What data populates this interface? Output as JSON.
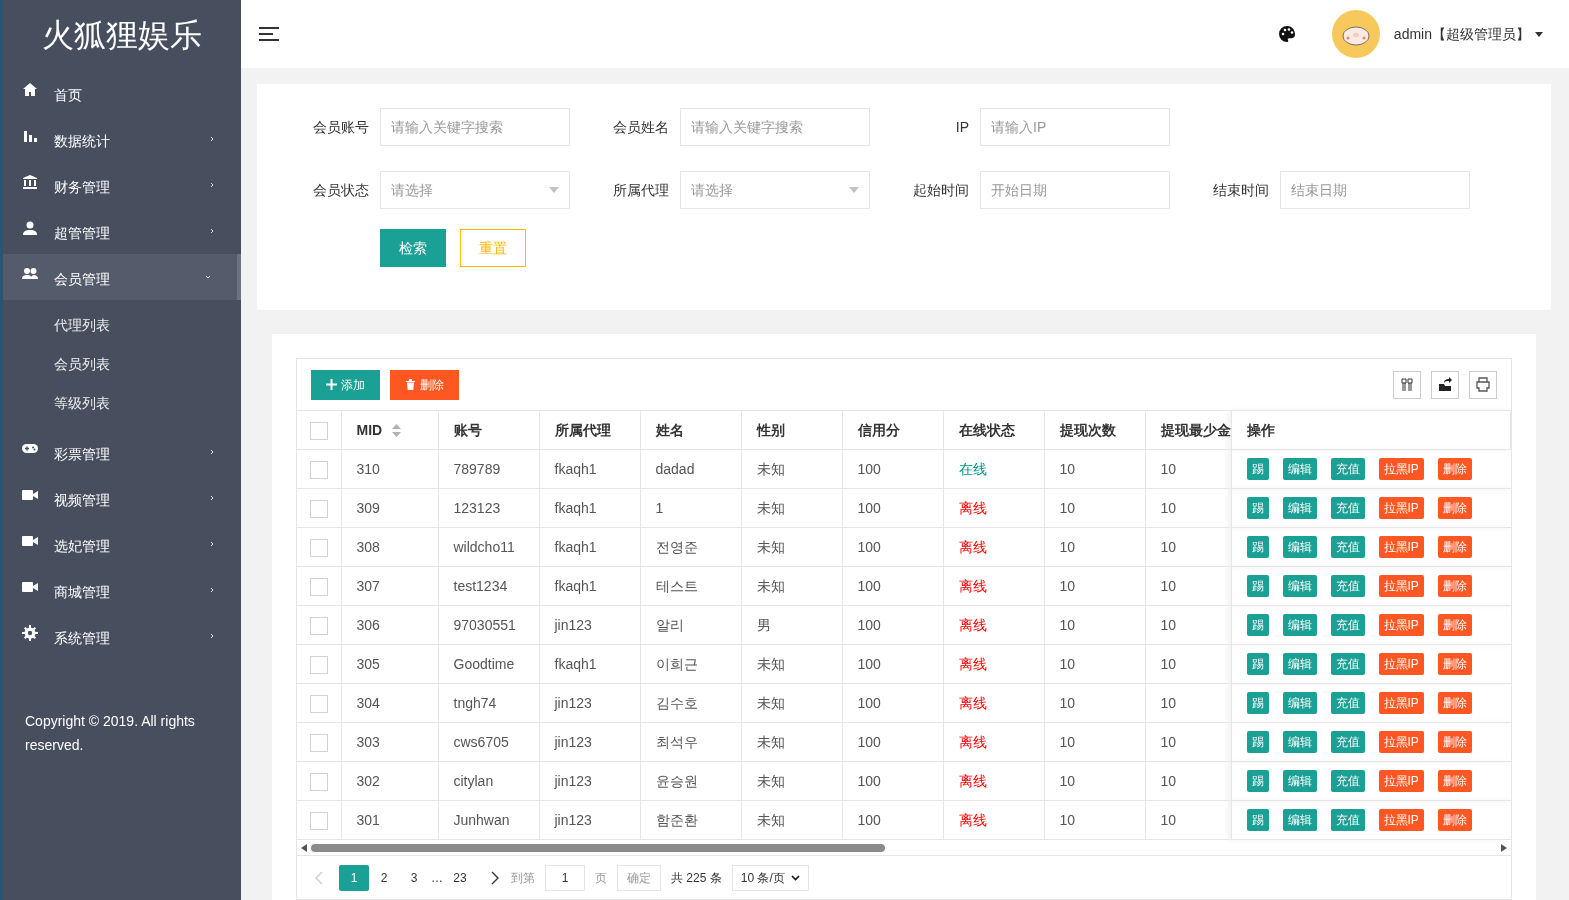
{
  "sidebar": {
    "logo": "火狐狸娱乐",
    "items": [
      {
        "kind": "home",
        "label": "首页",
        "has_children": false,
        "selected": false
      },
      {
        "kind": "chart",
        "label": "数据统计",
        "has_children": true,
        "expanded": false,
        "selected": false
      },
      {
        "kind": "bank",
        "label": "财务管理",
        "has_children": true,
        "expanded": false,
        "selected": false
      },
      {
        "kind": "user",
        "label": "超管管理",
        "has_children": true,
        "expanded": false,
        "selected": false
      },
      {
        "kind": "users",
        "label": "会员管理",
        "has_children": true,
        "expanded": true,
        "selected": true,
        "children": [
          {
            "label": "代理列表"
          },
          {
            "label": "会员列表"
          },
          {
            "label": "等级列表"
          }
        ]
      },
      {
        "kind": "gamepad",
        "label": "彩票管理",
        "has_children": true,
        "expanded": false,
        "selected": false
      },
      {
        "kind": "video",
        "label": "视频管理",
        "has_children": true,
        "expanded": false,
        "selected": false
      },
      {
        "kind": "video",
        "label": "选妃管理",
        "has_children": true,
        "expanded": false,
        "selected": false
      },
      {
        "kind": "video",
        "label": "商城管理",
        "has_children": true,
        "expanded": false,
        "selected": false
      },
      {
        "kind": "gear",
        "label": "系统管理",
        "has_children": true,
        "expanded": false,
        "selected": false
      }
    ],
    "copyright": "Copyright © 2019. All rights reserved."
  },
  "header": {
    "user": "admin【超级管理员】"
  },
  "filter_rows": [
    [
      {
        "label": "会员账号",
        "kind": "text",
        "placeholder": "请输入关键字搜索"
      },
      {
        "label": "会员姓名",
        "kind": "text",
        "placeholder": "请输入关键字搜索"
      },
      {
        "label": "IP",
        "kind": "text",
        "placeholder": "请输入IP"
      }
    ],
    [
      {
        "label": "会员状态",
        "kind": "select",
        "placeholder": "请选择"
      },
      {
        "label": "所属代理",
        "kind": "select",
        "placeholder": "请选择"
      },
      {
        "label": "起始时间",
        "kind": "text",
        "placeholder": "开始日期"
      },
      {
        "label": "结束时间",
        "kind": "text",
        "placeholder": "结束日期"
      }
    ]
  ],
  "filter_buttons": [
    {
      "label": "检索",
      "kind": "primary"
    },
    {
      "label": "重置",
      "kind": "outline"
    }
  ],
  "toolbar": [
    {
      "label": "添加",
      "kind": "add"
    },
    {
      "label": "删除",
      "kind": "delete"
    }
  ],
  "table": {
    "all_checked": false,
    "columns": [
      "MID",
      "账号",
      "所属代理",
      "姓名",
      "性别",
      "信用分",
      "在线状态",
      "提现次数",
      "提现最少金",
      "操作"
    ],
    "rows": [
      {
        "checked": false,
        "cells": [
          "310",
          "789789",
          "fkaqh1",
          "dadad",
          "未知",
          "100",
          "在线",
          "10",
          "10"
        ],
        "online": true,
        "actions": [
          {
            "label": "踢",
            "kind": "normal"
          },
          {
            "label": "编辑",
            "kind": "normal"
          },
          {
            "label": "充值",
            "kind": "normal"
          },
          {
            "label": "拉黑IP",
            "kind": "danger"
          },
          {
            "label": "删除",
            "kind": "danger"
          }
        ]
      },
      {
        "checked": false,
        "cells": [
          "309",
          "123123",
          "fkaqh1",
          "1",
          "未知",
          "100",
          "离线",
          "10",
          "10"
        ],
        "online": false,
        "actions": [
          {
            "label": "踢",
            "kind": "normal"
          },
          {
            "label": "编辑",
            "kind": "normal"
          },
          {
            "label": "充值",
            "kind": "normal"
          },
          {
            "label": "拉黑IP",
            "kind": "danger"
          },
          {
            "label": "删除",
            "kind": "danger"
          }
        ]
      },
      {
        "checked": false,
        "cells": [
          "308",
          "wildcho11",
          "fkaqh1",
          "전영준",
          "未知",
          "100",
          "离线",
          "10",
          "10"
        ],
        "online": false,
        "actions": [
          {
            "label": "踢",
            "kind": "normal"
          },
          {
            "label": "编辑",
            "kind": "normal"
          },
          {
            "label": "充值",
            "kind": "normal"
          },
          {
            "label": "拉黑IP",
            "kind": "danger"
          },
          {
            "label": "删除",
            "kind": "danger"
          }
        ]
      },
      {
        "checked": false,
        "cells": [
          "307",
          "test1234",
          "fkaqh1",
          "테스트",
          "未知",
          "100",
          "离线",
          "10",
          "10"
        ],
        "online": false,
        "actions": [
          {
            "label": "踢",
            "kind": "normal"
          },
          {
            "label": "编辑",
            "kind": "normal"
          },
          {
            "label": "充值",
            "kind": "normal"
          },
          {
            "label": "拉黑IP",
            "kind": "danger"
          },
          {
            "label": "删除",
            "kind": "danger"
          }
        ]
      },
      {
        "checked": false,
        "cells": [
          "306",
          "97030551",
          "jin123",
          "알리",
          "男",
          "100",
          "离线",
          "10",
          "10"
        ],
        "online": false,
        "actions": [
          {
            "label": "踢",
            "kind": "normal"
          },
          {
            "label": "编辑",
            "kind": "normal"
          },
          {
            "label": "充值",
            "kind": "normal"
          },
          {
            "label": "拉黑IP",
            "kind": "danger"
          },
          {
            "label": "删除",
            "kind": "danger"
          }
        ]
      },
      {
        "checked": false,
        "cells": [
          "305",
          "Goodtime",
          "fkaqh1",
          "이희근",
          "未知",
          "100",
          "离线",
          "10",
          "10"
        ],
        "online": false,
        "actions": [
          {
            "label": "踢",
            "kind": "normal"
          },
          {
            "label": "编辑",
            "kind": "normal"
          },
          {
            "label": "充值",
            "kind": "normal"
          },
          {
            "label": "拉黑IP",
            "kind": "danger"
          },
          {
            "label": "删除",
            "kind": "danger"
          }
        ]
      },
      {
        "checked": false,
        "cells": [
          "304",
          "tngh74",
          "jin123",
          "김수호",
          "未知",
          "100",
          "离线",
          "10",
          "10"
        ],
        "online": false,
        "actions": [
          {
            "label": "踢",
            "kind": "normal"
          },
          {
            "label": "编辑",
            "kind": "normal"
          },
          {
            "label": "充值",
            "kind": "normal"
          },
          {
            "label": "拉黑IP",
            "kind": "danger"
          },
          {
            "label": "删除",
            "kind": "danger"
          }
        ]
      },
      {
        "checked": false,
        "cells": [
          "303",
          "cws6705",
          "jin123",
          "최석우",
          "未知",
          "100",
          "离线",
          "10",
          "10"
        ],
        "online": false,
        "actions": [
          {
            "label": "踢",
            "kind": "normal"
          },
          {
            "label": "编辑",
            "kind": "normal"
          },
          {
            "label": "充值",
            "kind": "normal"
          },
          {
            "label": "拉黑IP",
            "kind": "danger"
          },
          {
            "label": "删除",
            "kind": "danger"
          }
        ]
      },
      {
        "checked": false,
        "cells": [
          "302",
          "citylan",
          "jin123",
          "윤승원",
          "未知",
          "100",
          "离线",
          "10",
          "10"
        ],
        "online": false,
        "actions": [
          {
            "label": "踢",
            "kind": "normal"
          },
          {
            "label": "编辑",
            "kind": "normal"
          },
          {
            "label": "充值",
            "kind": "normal"
          },
          {
            "label": "拉黑IP",
            "kind": "danger"
          },
          {
            "label": "删除",
            "kind": "danger"
          }
        ]
      },
      {
        "checked": false,
        "cells": [
          "301",
          "Junhwan",
          "jin123",
          "함준환",
          "未知",
          "100",
          "离线",
          "10",
          "10"
        ],
        "online": false,
        "actions": [
          {
            "label": "踢",
            "kind": "normal"
          },
          {
            "label": "编辑",
            "kind": "normal"
          },
          {
            "label": "充值",
            "kind": "normal"
          },
          {
            "label": "拉黑IP",
            "kind": "danger"
          },
          {
            "label": "删除",
            "kind": "danger"
          }
        ]
      }
    ]
  },
  "pagination": {
    "pages": [
      {
        "label": "1",
        "selected": true
      },
      {
        "label": "2",
        "selected": false
      },
      {
        "label": "3",
        "selected": false
      },
      {
        "label": "…",
        "kind": "ellipsis"
      },
      {
        "label": "23",
        "selected": false
      }
    ],
    "goto_label": "到第",
    "goto_value": "1",
    "page_unit": "页",
    "confirm": "确定",
    "total": "共 225 条",
    "per_page": "10 条/页"
  }
}
